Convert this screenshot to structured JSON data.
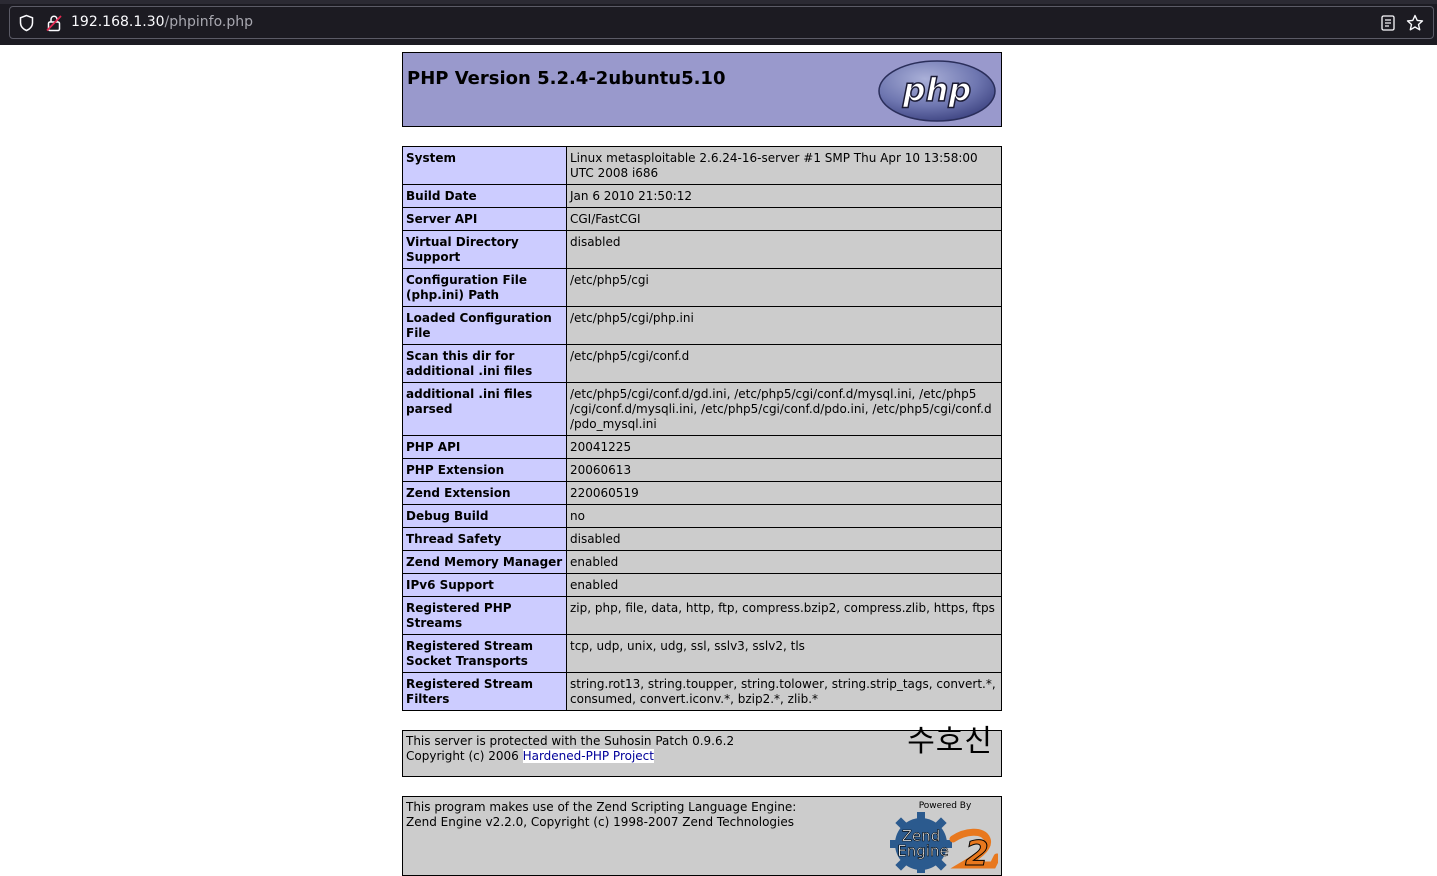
{
  "browser": {
    "url_host": "192.168.1.30",
    "url_path": "/phpinfo.php"
  },
  "header": {
    "title": "PHP Version 5.2.4-2ubuntu5.10",
    "logo_text": "php"
  },
  "info_rows": [
    {
      "key": "System",
      "value": "Linux metasploitable 2.6.24-16-server #1 SMP Thu Apr 10 13:58:00 UTC 2008 i686"
    },
    {
      "key": "Build Date",
      "value": "Jan 6 2010 21:50:12"
    },
    {
      "key": "Server API",
      "value": "CGI/FastCGI"
    },
    {
      "key": "Virtual Directory Support",
      "value": "disabled"
    },
    {
      "key": "Configuration File (php.ini) Path",
      "value": "/etc/php5/cgi"
    },
    {
      "key": "Loaded Configuration File",
      "value": "/etc/php5/cgi/php.ini"
    },
    {
      "key": "Scan this dir for additional .ini files",
      "value": "/etc/php5/cgi/conf.d"
    },
    {
      "key": "additional .ini files parsed",
      "value": "/etc/php5/cgi/conf.d/gd.ini, /etc/php5/cgi/conf.d/mysql.ini, /etc/php5 /cgi/conf.d/mysqli.ini, /etc/php5/cgi/conf.d/pdo.ini, /etc/php5/cgi/conf.d /pdo_mysql.ini"
    },
    {
      "key": "PHP API",
      "value": "20041225"
    },
    {
      "key": "PHP Extension",
      "value": "20060613"
    },
    {
      "key": "Zend Extension",
      "value": "220060519"
    },
    {
      "key": "Debug Build",
      "value": "no"
    },
    {
      "key": "Thread Safety",
      "value": "disabled"
    },
    {
      "key": "Zend Memory Manager",
      "value": "enabled"
    },
    {
      "key": "IPv6 Support",
      "value": "enabled"
    },
    {
      "key": "Registered PHP Streams",
      "value": "zip, php, file, data, http, ftp, compress.bzip2, compress.zlib, https, ftps"
    },
    {
      "key": "Registered Stream Socket Transports",
      "value": "tcp, udp, unix, udg, ssl, sslv3, sslv2, tls"
    },
    {
      "key": "Registered Stream Filters",
      "value": "string.rot13, string.toupper, string.tolower, string.strip_tags, convert.*, consumed, convert.iconv.*, bzip2.*, zlib.*"
    }
  ],
  "suhosin": {
    "line1": "This server is protected with the Suhosin Patch 0.9.6.2",
    "line2_prefix": "Copyright (c) 2006 ",
    "link_text": "Hardened-PHP Project",
    "logo_text": "수호신"
  },
  "zend": {
    "line1": "This program makes use of the Zend Scripting Language Engine:",
    "line2": "Zend Engine v2.2.0, Copyright (c) 1998-2007 Zend Technologies",
    "logo_powered": "Powered By",
    "logo_line1": "Zend",
    "logo_line2": "Engine",
    "logo_number": "2"
  },
  "colors": {
    "header_bg": "#9999cc",
    "key_bg": "#ccccff",
    "value_bg": "#cccccc",
    "link": "#000099"
  }
}
